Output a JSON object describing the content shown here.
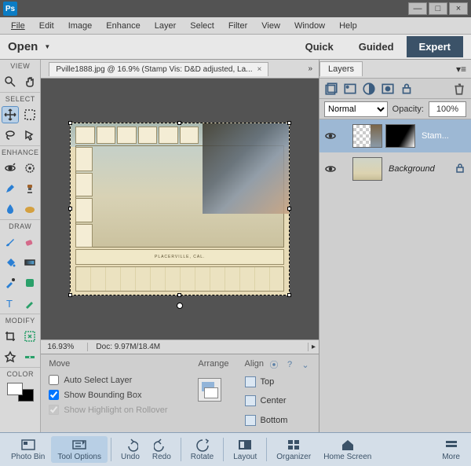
{
  "menubar": [
    "File",
    "Edit",
    "Image",
    "Enhance",
    "Layer",
    "Select",
    "Filter",
    "View",
    "Window",
    "Help"
  ],
  "modebar": {
    "open": "Open",
    "modes": [
      "Quick",
      "Guided",
      "Expert"
    ],
    "active": "Expert"
  },
  "toolbox": {
    "sections": {
      "view": "VIEW",
      "select": "SELECT",
      "enhance": "ENHANCE",
      "draw": "DRAW",
      "modify": "MODIFY",
      "color": "COLOR"
    }
  },
  "document": {
    "tab_title": "Pville1888.jpg @ 16.9% (Stamp Vis: D&D adjusted, La...",
    "zoom": "16.93%",
    "docinfo": "Doc: 9.97M/18.4M",
    "title_band": "PLACERVILLE, CAL."
  },
  "options": {
    "tool": "Move",
    "auto_select": "Auto Select Layer",
    "bounding": "Show Bounding Box",
    "rollover": "Show Highlight on Rollover",
    "arrange": "Arrange",
    "align": "Align",
    "align_items": [
      "Top",
      "Center",
      "Bottom"
    ]
  },
  "layers_panel": {
    "title": "Layers",
    "blend": "Normal",
    "opacity_label": "Opacity:",
    "opacity_value": "100%",
    "layers": [
      {
        "name": "Stam...",
        "selected": true,
        "mask": true
      },
      {
        "name": "Background",
        "selected": false,
        "locked": true,
        "italic": true
      }
    ]
  },
  "bottombar": {
    "items": [
      "Photo Bin",
      "Tool Options",
      "Undo",
      "Redo",
      "Rotate",
      "Layout",
      "Organizer",
      "Home Screen"
    ],
    "more": "More",
    "active": "Tool Options"
  }
}
